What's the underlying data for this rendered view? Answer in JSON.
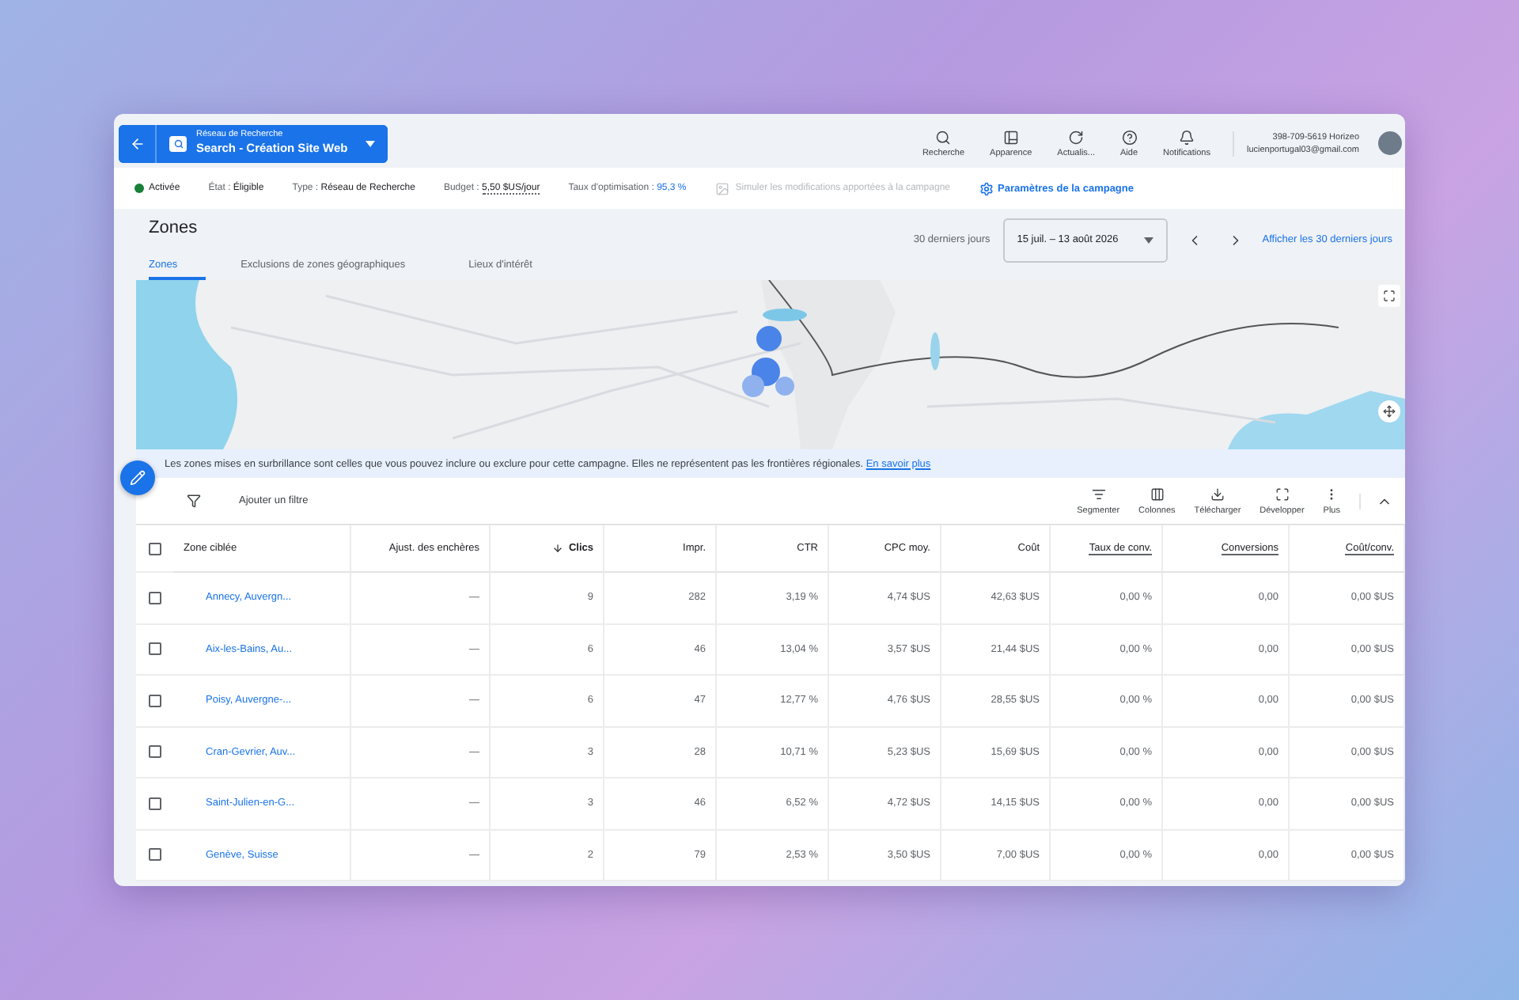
{
  "header": {
    "campaign_type": "Réseau de Recherche",
    "campaign_name": "Search - Création Site Web"
  },
  "top_actions": [
    {
      "kind": "search",
      "label": "Recherche"
    },
    {
      "kind": "appearance",
      "label": "Apparence"
    },
    {
      "kind": "refresh",
      "label": "Actualis..."
    },
    {
      "kind": "help",
      "label": "Aide"
    },
    {
      "kind": "bell",
      "label": "Notifications"
    }
  ],
  "account": {
    "id": "398-709-5619 Horizeo",
    "email": "lucienportugal03@gmail.com"
  },
  "summary": {
    "status": "Activée",
    "items": [
      {
        "kind": "plain",
        "label": "État :",
        "value": "Éligible"
      },
      {
        "kind": "plain",
        "label": "Type :",
        "value": "Réseau de Recherche"
      },
      {
        "kind": "dotted",
        "label": "Budget :",
        "value": "5,50 $US/jour"
      },
      {
        "kind": "link",
        "label": "Taux d'optimisation :",
        "value": "95,3 %"
      }
    ],
    "simulate": {
      "label": "Simuler les modifications apportées à la campagne",
      "disabled": true
    },
    "settings_link": "Paramètres de la campagne"
  },
  "page_title": "Zones",
  "tabs": [
    {
      "label": "Zones",
      "selected": true
    },
    {
      "label": "Exclusions de zones géographiques",
      "selected": false
    },
    {
      "label": "Lieux d'intérêt",
      "selected": false
    }
  ],
  "date": {
    "range_label": "30 derniers jours",
    "value": "15 juil. – 13 août 2026",
    "show_link": "Afficher les 30 derniers jours"
  },
  "info": {
    "text": "Les zones mises en surbrillance sont celles que vous pouvez inclure ou exclure pour cette campagne. Elles ne représentent pas les frontières régionales.",
    "link": "En savoir plus"
  },
  "filter": {
    "label": "Ajouter un filtre"
  },
  "table_tools": [
    {
      "kind": "segment",
      "label": "Segmenter"
    },
    {
      "kind": "columns",
      "label": "Colonnes"
    },
    {
      "kind": "download",
      "label": "Télécharger"
    },
    {
      "kind": "expand",
      "label": "Développer"
    },
    {
      "kind": "more",
      "label": "Plus"
    }
  ],
  "table": {
    "select_all": false,
    "columns": [
      {
        "kind": "left",
        "label": "Zone ciblée"
      },
      {
        "kind": "right",
        "label": "Ajust. des enchères"
      },
      {
        "kind": "sorted",
        "label": "Clics"
      },
      {
        "kind": "right",
        "label": "Impr."
      },
      {
        "kind": "right",
        "label": "CTR"
      },
      {
        "kind": "right",
        "label": "CPC moy."
      },
      {
        "kind": "right",
        "label": "Coût"
      },
      {
        "kind": "underlined",
        "label": "Taux de conv."
      },
      {
        "kind": "underlined",
        "label": "Conversions"
      },
      {
        "kind": "underlined",
        "label": "Coût/conv."
      }
    ],
    "rows": [
      {
        "checked": false,
        "cells": [
          "Annecy, Auvergn...",
          "—",
          "9",
          "282",
          "3,19 %",
          "4,74 $US",
          "42,63 $US",
          "0,00 %",
          "0,00",
          "0,00 $US"
        ]
      },
      {
        "checked": false,
        "cells": [
          "Aix-les-Bains, Au...",
          "—",
          "6",
          "46",
          "13,04 %",
          "3,57 $US",
          "21,44 $US",
          "0,00 %",
          "0,00",
          "0,00 $US"
        ]
      },
      {
        "checked": false,
        "cells": [
          "Poisy, Auvergne-...",
          "—",
          "6",
          "47",
          "12,77 %",
          "4,76 $US",
          "28,55 $US",
          "0,00 %",
          "0,00",
          "0,00 $US"
        ]
      },
      {
        "checked": false,
        "cells": [
          "Cran-Gevrier, Auv...",
          "—",
          "3",
          "28",
          "10,71 %",
          "5,23 $US",
          "15,69 $US",
          "0,00 %",
          "0,00",
          "0,00 $US"
        ]
      },
      {
        "checked": false,
        "cells": [
          "Saint-Julien-en-G...",
          "—",
          "3",
          "46",
          "6,52 %",
          "4,72 $US",
          "14,15 $US",
          "0,00 %",
          "0,00",
          "0,00 $US"
        ]
      },
      {
        "checked": false,
        "cells": [
          "Genève, Suisse",
          "—",
          "2",
          "79",
          "2,53 %",
          "3,50 $US",
          "7,00 $US",
          "0,00 %",
          "0,00",
          "0,00 $US"
        ]
      }
    ]
  }
}
